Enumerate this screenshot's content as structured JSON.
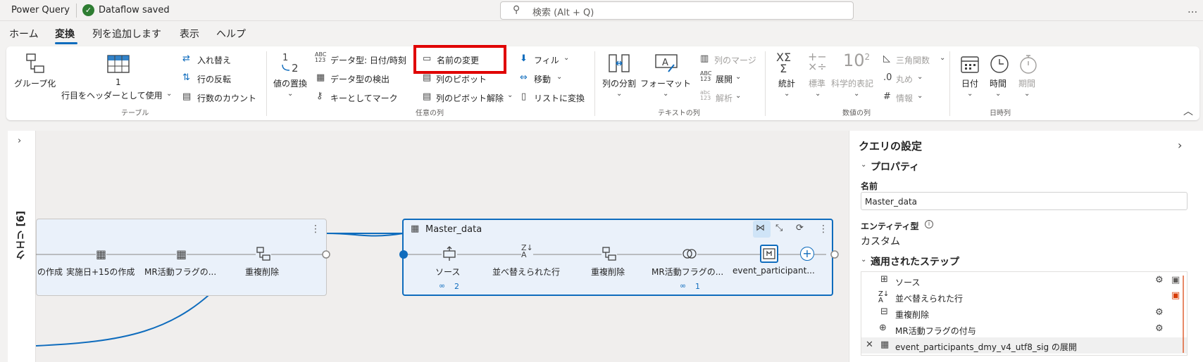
{
  "titlebar": {
    "app_title": "Power Query",
    "saved_status": "Dataflow saved",
    "search_placeholder": "検索 (Alt + Q)",
    "more": "..."
  },
  "tabs": [
    "ホーム",
    "変換",
    "列を追加します",
    "表示",
    "ヘルプ"
  ],
  "active_tab": "変換",
  "ribbon": {
    "table": {
      "group_label": "テーブル",
      "group_by": "グループ化",
      "first_row_header_line1": "1",
      "first_row_header_line2": "行目をヘッダーとして使用",
      "transpose": "入れ替え",
      "reverse_rows": "行の反転",
      "count_rows": "行数のカウント"
    },
    "any_column": {
      "group_label": "任意の列",
      "replace_values": "値の置換",
      "data_type": "データ型: 日付/時刻",
      "detect_type": "データ型の検出",
      "mark_as_key": "キーとしてマーク",
      "rename": "名前の変更",
      "pivot": "列のピボット",
      "unpivot": "列のピボット解除",
      "fill": "フィル",
      "move": "移動",
      "convert_to_list": "リストに変換"
    },
    "text_column": {
      "group_label": "テキストの列",
      "split_column": "列の分割",
      "format": "フォーマット",
      "merge_columns": "列のマージ",
      "extract": "展開",
      "parse": "解析"
    },
    "number_column": {
      "group_label": "数値の列",
      "statistics": "統計",
      "standard": "標準",
      "scientific": "科学的表記",
      "trig": "三角関数",
      "rounding": "丸め",
      "information": "情報"
    },
    "datetime_column": {
      "group_label": "日時列",
      "date": "日付",
      "time": "時間",
      "duration": "期間"
    }
  },
  "queries_pane": {
    "label": "クエリ [6]"
  },
  "diagram": {
    "left_node": {
      "steps": [
        "の作成",
        "実施日+15の作成",
        "MR活動フラグの...",
        "重複削除"
      ]
    },
    "master_node": {
      "title": "Master_data",
      "steps": [
        "ソース",
        "並べ替えられた行",
        "重複削除",
        "MR活動フラグの...",
        "event_participant..."
      ],
      "source_links": "2",
      "flag_links": "1"
    }
  },
  "settings": {
    "title": "クエリの設定",
    "properties_header": "プロパティ",
    "name_label": "名前",
    "name_value": "Master_data",
    "entity_type_label": "エンティティ型",
    "entity_type_value": "カスタム",
    "applied_steps_header": "適用されたステップ",
    "applied_steps": [
      "ソース",
      "並べ替えられた行",
      "重複削除",
      "MR活動フラグの付与",
      "event_participants_dmy_v4_utf8_sig の展開"
    ]
  },
  "colors": {
    "accent": "#0f6cbd",
    "highlight_box": "#e00000",
    "saved_icon": "#2e7d32",
    "warning": "#d83b01"
  }
}
